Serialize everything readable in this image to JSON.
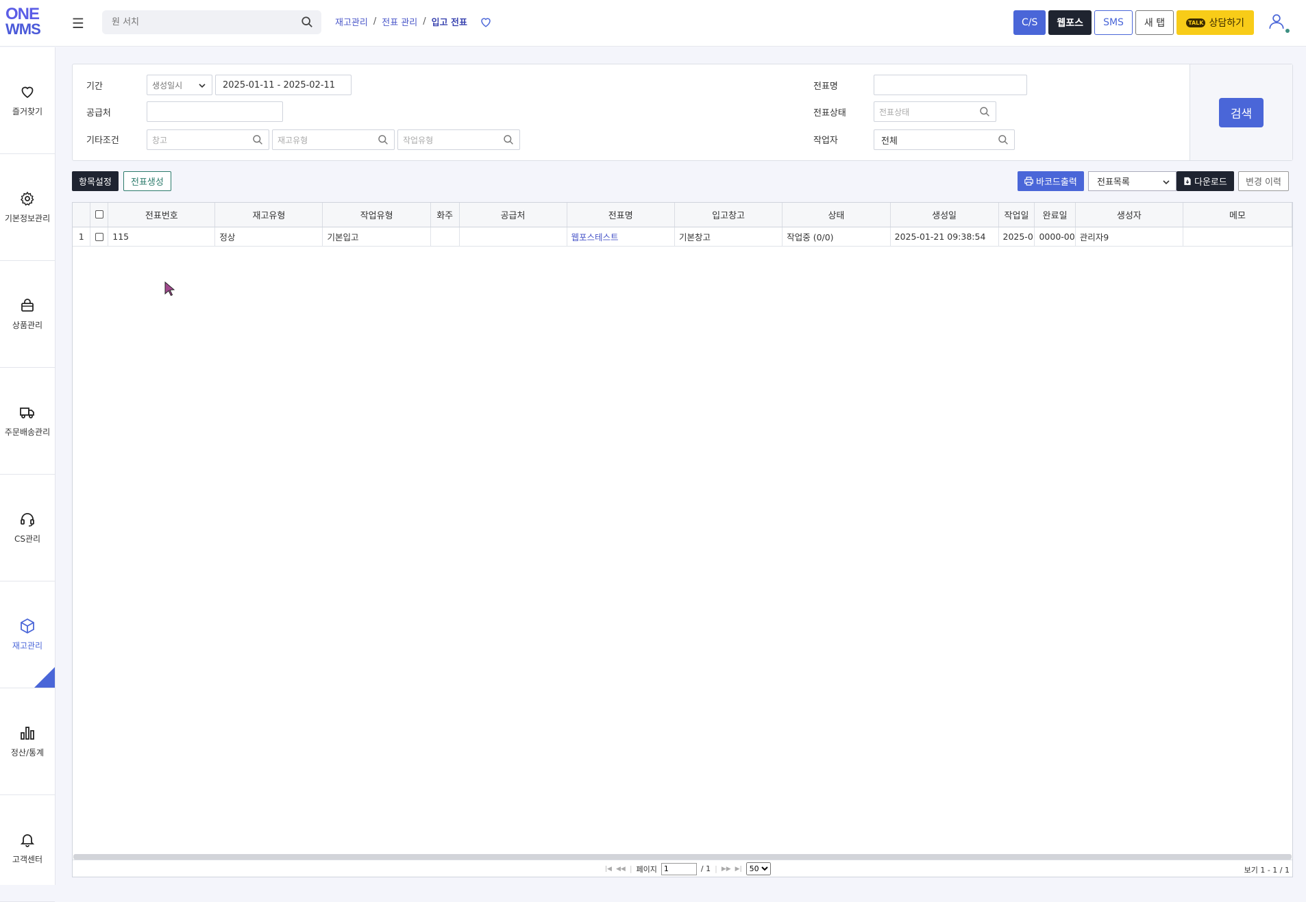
{
  "header": {
    "logo_line1": "ONE",
    "logo_line2": "WMS",
    "search_placeholder": "원 서치",
    "breadcrumb": [
      "재고관리",
      "전표 관리",
      "입고 전표"
    ],
    "buttons": {
      "cs": "C/S",
      "webfos": "웹포스",
      "sms": "SMS",
      "newtab": "새 탭",
      "talk_badge": "TALK",
      "talk": "상담하기"
    }
  },
  "sidebar": {
    "items": [
      {
        "label": "즐거찾기",
        "icon": "heart-icon"
      },
      {
        "label": "기본정보관리",
        "icon": "gear-icon"
      },
      {
        "label": "상품관리",
        "icon": "bag-icon"
      },
      {
        "label": "주문배송관리",
        "icon": "truck-icon"
      },
      {
        "label": "CS관리",
        "icon": "headset-icon"
      },
      {
        "label": "재고관리",
        "icon": "box-icon",
        "active": true
      },
      {
        "label": "정산/통계",
        "icon": "bar-chart-icon"
      },
      {
        "label": "고객센터",
        "icon": "bell-icon"
      }
    ]
  },
  "filters": {
    "period_label": "기간",
    "period_type": "생성일시",
    "period_range": "2025-01-11 - 2025-02-11",
    "supplier_label": "공급처",
    "supplier_value": "",
    "etc_label": "기타조건",
    "warehouse_placeholder": "창고",
    "stock_type_placeholder": "재고유형",
    "work_type_placeholder": "작업유형",
    "slip_name_label": "전표명",
    "slip_name_value": "",
    "slip_status_label": "전표상태",
    "slip_status_placeholder": "전표상태",
    "worker_label": "작업자",
    "worker_value": "전체",
    "search_button": "검색"
  },
  "toolbar": {
    "settings": "항목설정",
    "create": "전표생성",
    "barcode": "바코드출력",
    "list_select": "전표목록",
    "download": "다운로드",
    "history": "변경 이력"
  },
  "table": {
    "columns": [
      "전표번호",
      "재고유형",
      "작업유형",
      "화주",
      "공급처",
      "전표명",
      "입고창고",
      "상태",
      "생성일",
      "작업일",
      "완료일",
      "생성자",
      "메모"
    ],
    "rows": [
      {
        "index": "1",
        "slip_no": "115",
        "stock_type": "정상",
        "work_type": "기본입고",
        "owner": "",
        "supplier": "",
        "slip_name": "웹포스테스트",
        "warehouse": "기본창고",
        "status": "작업중 (0/0)",
        "created": "2025-01-21 09:38:54",
        "worked": "2025-0",
        "completed": "0000-00",
        "creator": "관리자9",
        "memo": ""
      }
    ]
  },
  "pager": {
    "page_label": "페이지",
    "page_value": "1",
    "total_pages": "/ 1",
    "page_size": "50",
    "view_text": "보기 1 - 1 / 1"
  }
}
